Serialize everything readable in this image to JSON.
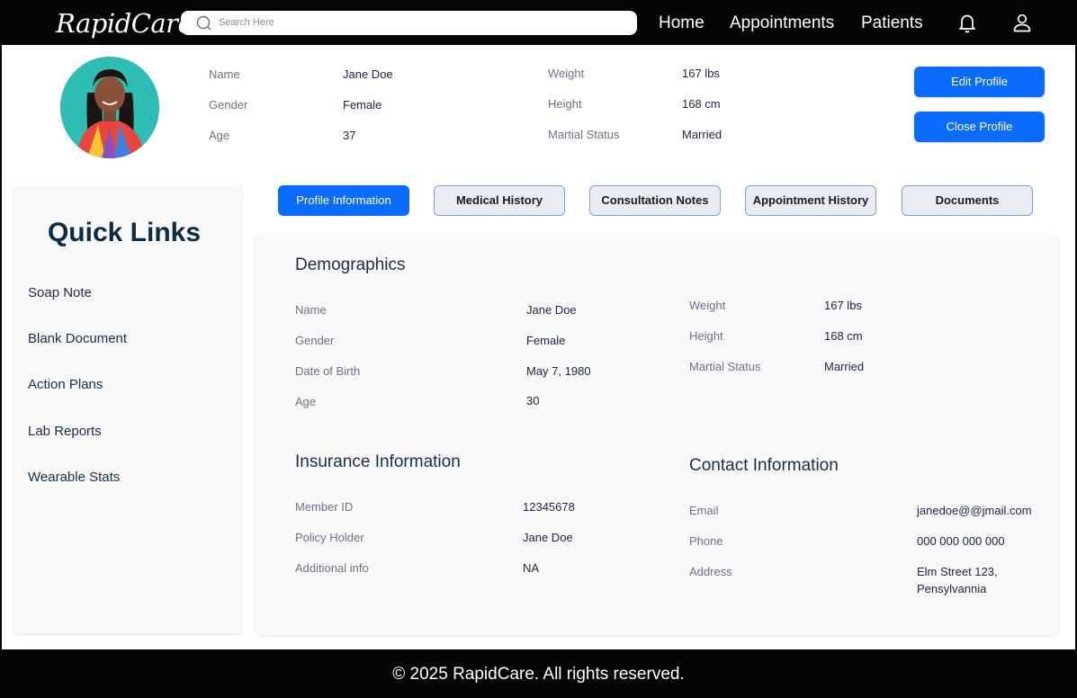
{
  "brand": "RapidCare",
  "search": {
    "placeholder": "Search Here"
  },
  "nav": {
    "home": "Home",
    "appointments": "Appointments",
    "patients": "Patients"
  },
  "icons": {
    "search": "search-icon",
    "notifications": "bell-icon",
    "account": "user-icon"
  },
  "profile": {
    "name_label": "Name",
    "name": "Jane Doe",
    "gender_label": "Gender",
    "gender": "Female",
    "age_label": "Age",
    "age": "37",
    "weight_label": "Weight",
    "weight": "167 lbs",
    "height_label": "Height",
    "height": "168 cm",
    "marital_label": "Martial Status",
    "marital": "Married",
    "edit_button": "Edit Profile",
    "close_button": "Close Profile"
  },
  "quick_links": {
    "title": "Quick Links",
    "items": [
      "Soap Note",
      "Blank Document",
      "Action Plans",
      "Lab Reports",
      "Wearable Stats"
    ]
  },
  "tabs": [
    "Profile Information",
    "Medical History",
    "Consultation Notes",
    "Appointment History",
    "Documents"
  ],
  "demographics": {
    "title": "Demographics",
    "name_label": "Name",
    "name": "Jane Doe",
    "gender_label": "Gender",
    "gender": "Female",
    "dob_label": "Date of Birth",
    "dob": "May 7, 1980",
    "age_label": "Age",
    "age": "30",
    "weight_label": "Weight",
    "weight": "167 lbs",
    "height_label": "Height",
    "height": "168 cm",
    "marital_label": "Martial Status",
    "marital": "Married"
  },
  "insurance": {
    "title": "Insurance Information",
    "member_label": "Member ID",
    "member": "12345678",
    "holder_label": "Policy Holder",
    "holder": "Jane Doe",
    "additional_label": "Additional info",
    "additional": "NA"
  },
  "contact": {
    "title": "Contact Information",
    "email_label": "Email",
    "email": "janedoe@@jmail.com",
    "phone_label": "Phone",
    "phone": "000 000 000 000",
    "address_label": "Address",
    "address_line1": "Elm Street 123,",
    "address_line2": "Pensylvannia"
  },
  "colors": {
    "primary": "#0a6cff",
    "nav_bg": "#050505",
    "card_bg": "#f8f8f9",
    "heading": "#0c2b45"
  },
  "footer": "© 2025 RapidCare. All rights reserved."
}
